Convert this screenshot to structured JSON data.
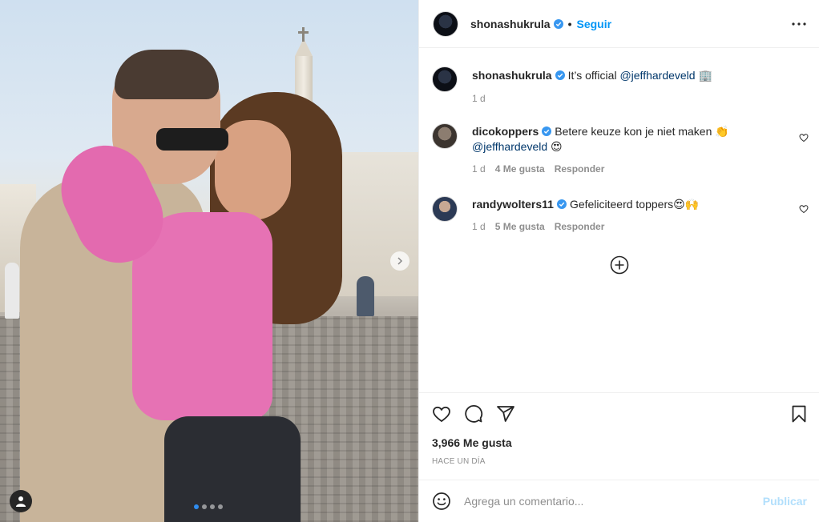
{
  "post": {
    "author": "shonashukrula",
    "follow_label": "Seguir",
    "separator": "•",
    "more_icon": "more-horizontal-icon",
    "carousel": {
      "dots": 4,
      "active_index": 0
    }
  },
  "caption": {
    "username": "shonashukrula",
    "text": "It’s official ",
    "mention": "@jeffhardeveld",
    "emoji": "🏢",
    "time": "1 d"
  },
  "comments": [
    {
      "username": "dicokoppers",
      "text": "Betere keuze kon je niet maken 👏",
      "mention": "@jeffhardeveld",
      "emoji": "😍",
      "time": "1 d",
      "likes": "4 Me gusta",
      "reply": "Responder"
    },
    {
      "username": "randywolters11",
      "text": "Gefeliciteerd toppers😍🙌",
      "time": "1 d",
      "likes": "5 Me gusta",
      "reply": "Responder"
    }
  ],
  "actions": {
    "likes_count": "3,966 Me gusta",
    "time_ago": "HACE UN DÍA"
  },
  "add_comment": {
    "placeholder": "Agrega un comentario...",
    "publish_label": "Publicar"
  },
  "colors": {
    "accent": "#0095f6",
    "verified": "#3897f0",
    "publish_disabled": "#b2dffc",
    "mention": "#00376b"
  }
}
